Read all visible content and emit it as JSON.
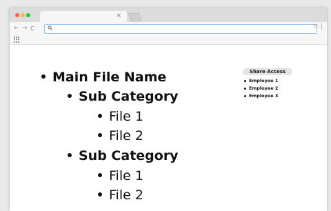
{
  "browser": {
    "tab_close": "×",
    "nav_back": "←",
    "nav_forward": "→",
    "nav_reload": "C",
    "search_icon": "magnifier",
    "bookmark_icon": "☆",
    "menu_icon": "⋮"
  },
  "tree": {
    "root": "Main File Name",
    "sub1": "Sub Category",
    "sub1_file1": "File 1",
    "sub1_file2": "File 2",
    "sub2": "Sub Category",
    "sub2_file1": "File 1",
    "sub2_file2": "File 2"
  },
  "share": {
    "title": "Share Access",
    "members": [
      "Employee 1",
      "Employee 2",
      "Employee 3"
    ]
  }
}
